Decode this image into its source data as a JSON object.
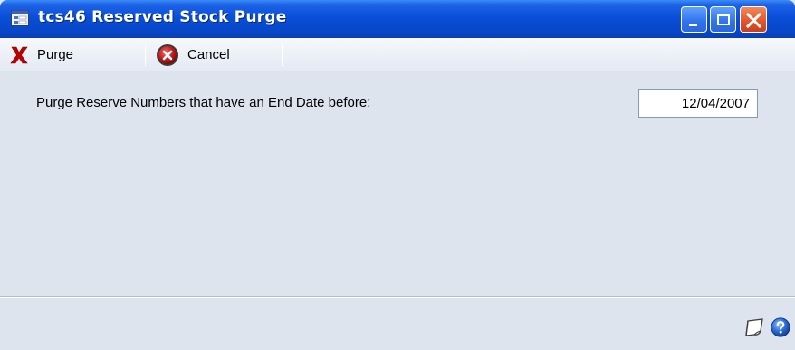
{
  "window": {
    "title": "tcs46 Reserved Stock Purge",
    "icon": "window-form-icon"
  },
  "toolbar": {
    "purge_label": "Purge",
    "purge_icon": "red-x-icon",
    "cancel_label": "Cancel",
    "cancel_icon": "cancel-circle-icon"
  },
  "form": {
    "date_label": "Purge Reserve Numbers that have an End Date before:",
    "end_date_value": "12/04/2007"
  },
  "statusbar": {
    "icons": [
      "note-icon",
      "help-icon"
    ]
  },
  "colors": {
    "titlebar_blue": "#0a4fd9",
    "body_background": "#dde4ee",
    "close_button": "#e2582e",
    "purge_red": "#c00000"
  }
}
